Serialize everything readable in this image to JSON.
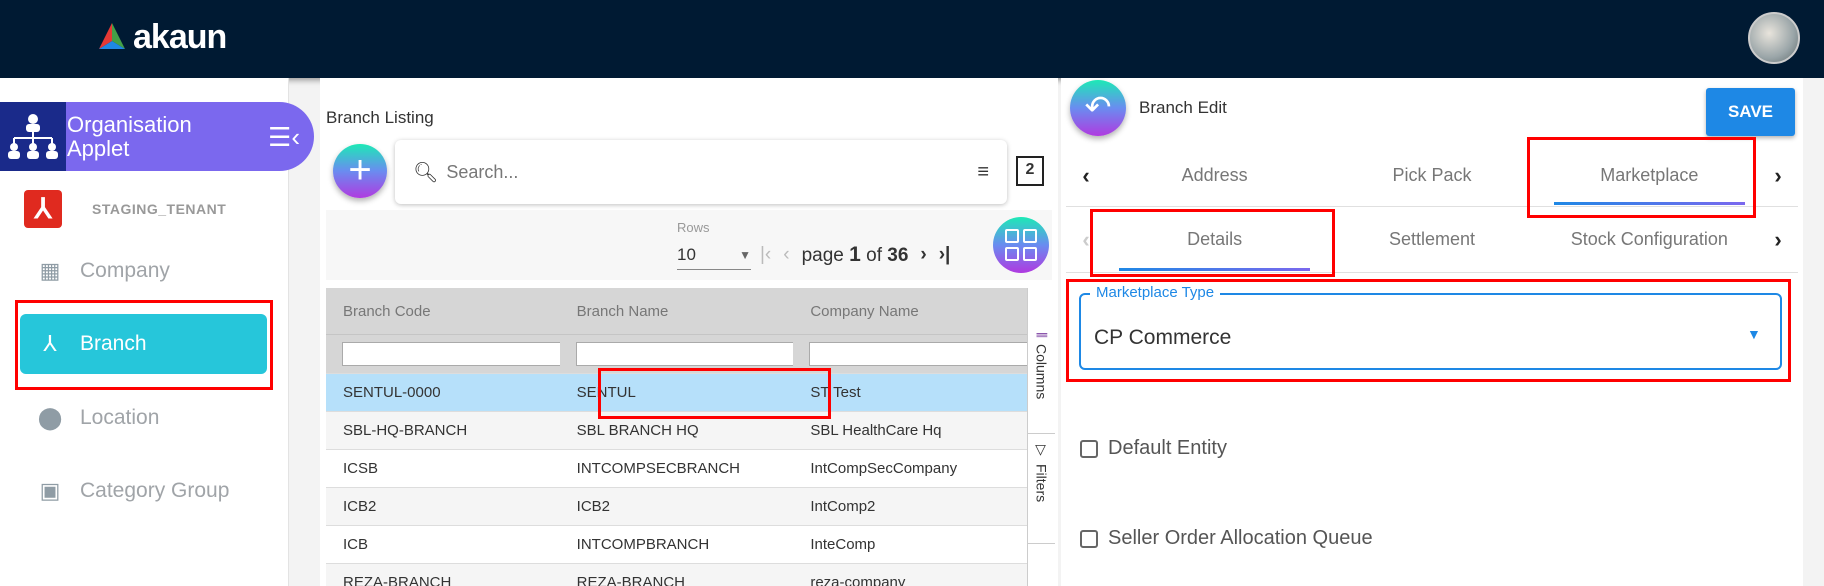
{
  "header": {
    "logo_text": "akaun",
    "avatar": "user-avatar"
  },
  "sidebar": {
    "applet_title": "Organisation Applet",
    "tenant_name": "STAGING_TENANT",
    "items": [
      {
        "label": "Company",
        "icon": "building-icon"
      },
      {
        "label": "Branch",
        "icon": "branch-icon",
        "active": true
      },
      {
        "label": "Location",
        "icon": "location-pin-icon"
      },
      {
        "label": "Category Group",
        "icon": "wallet-icon"
      }
    ]
  },
  "listing": {
    "title": "Branch Listing",
    "search_placeholder": "Search...",
    "column_count": "2",
    "rows_label": "Rows",
    "rows_value": "10",
    "page_word": "page",
    "page_current": "1",
    "of_word": "of",
    "page_total": "36",
    "columns": [
      "Branch Code",
      "Branch Name",
      "Company Name"
    ],
    "rows": [
      [
        "SENTUL-0000",
        "SENTUL",
        "ST Test"
      ],
      [
        "SBL-HQ-BRANCH",
        "SBL BRANCH HQ",
        "SBL HealthCare Hq"
      ],
      [
        "ICSB",
        "INTCOMPSECBRANCH",
        "IntCompSecCompany"
      ],
      [
        "ICB2",
        "ICB2",
        "IntComp2"
      ],
      [
        "ICB",
        "INTCOMPBRANCH",
        "InteComp"
      ],
      [
        "REZA-BRANCH",
        "REZA-BRANCH",
        "reza-company"
      ]
    ],
    "side_tabs": [
      "Columns",
      "Filters"
    ]
  },
  "edit": {
    "title": "Branch Edit",
    "save_label": "SAVE",
    "tabs": [
      "Address",
      "Pick Pack",
      "Marketplace"
    ],
    "subtabs": [
      "Details",
      "Settlement",
      "Stock Configuration"
    ],
    "field_label": "Marketplace Type",
    "field_value": "CP Commerce",
    "checkboxes": [
      "Default Entity",
      "Seller Order Allocation Queue"
    ]
  },
  "colors": {
    "topbar": "#001a33",
    "accent": "#1e88e5",
    "active_nav": "#26c6da",
    "applet": "#7b68ee",
    "highlight": "#ff0000"
  }
}
